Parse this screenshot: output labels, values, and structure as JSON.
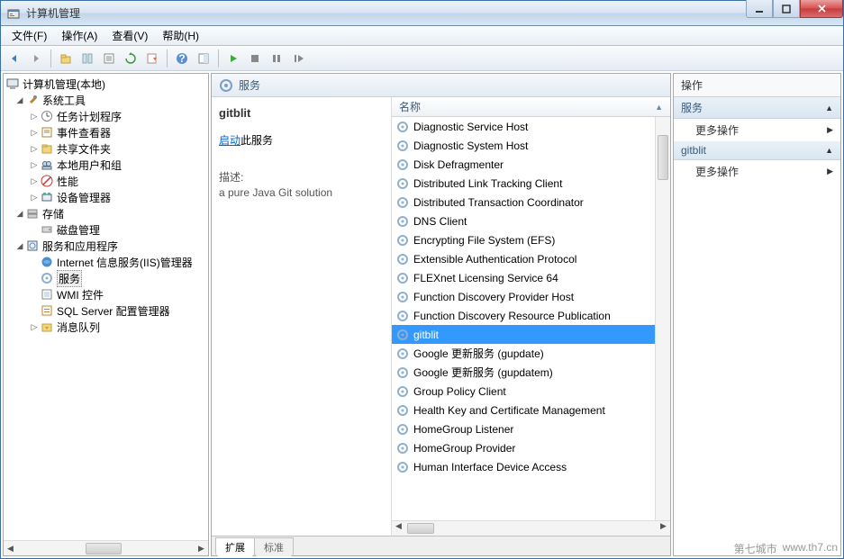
{
  "window": {
    "title": "计算机管理"
  },
  "menu": {
    "file": "文件(F)",
    "action": "操作(A)",
    "view": "查看(V)",
    "help": "帮助(H)"
  },
  "tree": {
    "root": "计算机管理(本地)",
    "sys_tools": "系统工具",
    "sys_children": [
      "任务计划程序",
      "事件查看器",
      "共享文件夹",
      "本地用户和组",
      "性能",
      "设备管理器"
    ],
    "storage": "存储",
    "storage_children": [
      "磁盘管理"
    ],
    "services_apps": "服务和应用程序",
    "sa_children": [
      "Internet 信息服务(IIS)管理器",
      "服务",
      "WMI 控件",
      "SQL Server 配置管理器",
      "消息队列"
    ]
  },
  "center": {
    "header": "服务",
    "detail_title": "gitblit",
    "start_link": "启动",
    "start_suffix": "此服务",
    "desc_label": "描述:",
    "desc_text": "a pure Java Git solution",
    "col_name": "名称",
    "services": [
      "Diagnostic Service Host",
      "Diagnostic System Host",
      "Disk Defragmenter",
      "Distributed Link Tracking Client",
      "Distributed Transaction Coordinator",
      "DNS Client",
      "Encrypting File System (EFS)",
      "Extensible Authentication Protocol",
      "FLEXnet Licensing Service 64",
      "Function Discovery Provider Host",
      "Function Discovery Resource Publication",
      "gitblit",
      "Google 更新服务 (gupdate)",
      "Google 更新服务 (gupdatem)",
      "Group Policy Client",
      "Health Key and Certificate Management",
      "HomeGroup Listener",
      "HomeGroup Provider",
      "Human Interface Device Access"
    ],
    "selected_index": 11,
    "tabs": {
      "ext": "扩展",
      "std": "标准"
    }
  },
  "actions": {
    "title": "操作",
    "section1": "服务",
    "more1": "更多操作",
    "section2": "gitblit",
    "more2": "更多操作"
  },
  "watermark": {
    "a": "第七城市",
    "b": "www.th7.cn"
  }
}
